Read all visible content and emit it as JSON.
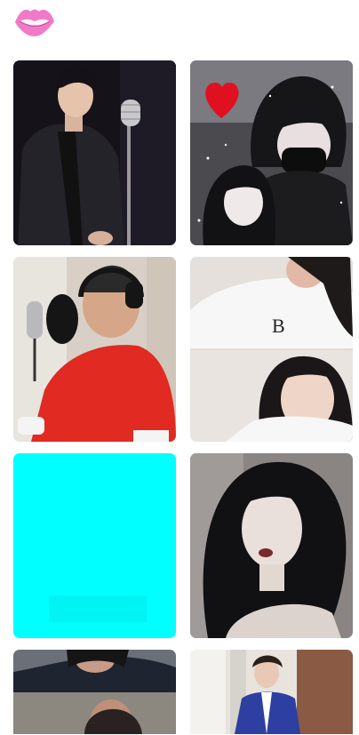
{
  "header": {
    "logo_icon": "lips-icon",
    "logo_color": "#f07ac8"
  },
  "feed": {
    "cards": [
      {
        "id": "card-1",
        "subject": "singer-with-microphone",
        "bg": "#15121a"
      },
      {
        "id": "card-2",
        "subject": "anime-couple-heart",
        "bg": "#3a3a3f",
        "accent": "#e01020"
      },
      {
        "id": "card-3",
        "subject": "studio-singer-red-sweater",
        "bg": "#d8d0c6",
        "accent": "#e02a22"
      },
      {
        "id": "card-4",
        "subject": "girl-photo-collage",
        "bg": "#e9e4e0"
      },
      {
        "id": "card-5",
        "subject": "cyan-placeholder",
        "bg": "#00ffff"
      },
      {
        "id": "card-6",
        "subject": "girl-portrait-dark",
        "bg": "#7a7572"
      },
      {
        "id": "card-7",
        "subject": "woman-outdoor-collage",
        "bg": "#6b6f78"
      },
      {
        "id": "card-8",
        "subject": "girl-blue-jacket",
        "bg": "#e8e3dc",
        "accent": "#2d3fa0"
      }
    ]
  }
}
